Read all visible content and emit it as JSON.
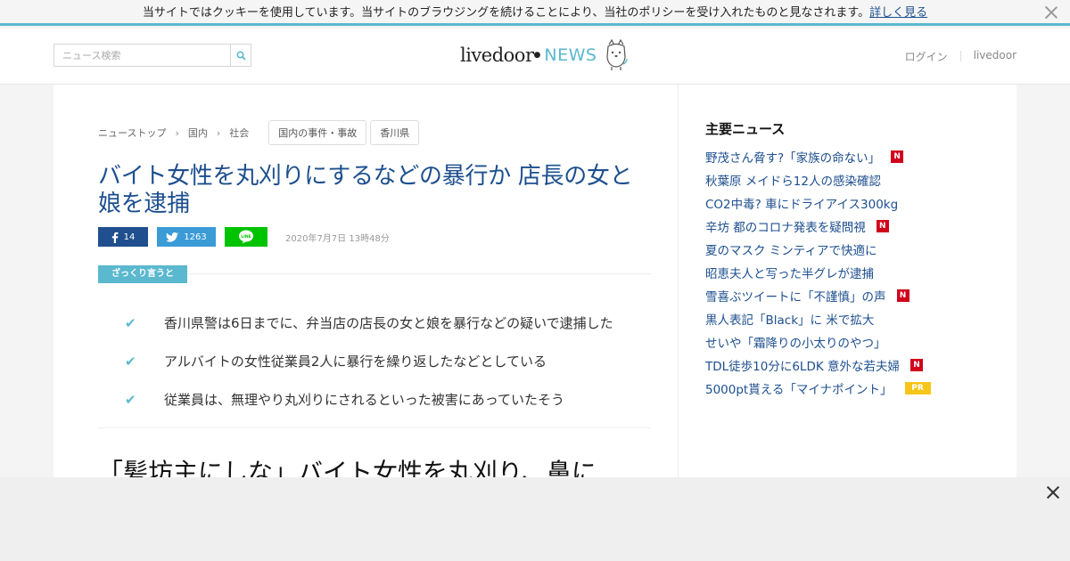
{
  "cookie": {
    "text": "当サイトではクッキーを使用しています。当サイトのブラウジングを続けることにより、当社のポリシーを受け入れたものと見なされます。",
    "learn_more": "詳しく見る"
  },
  "header": {
    "search_placeholder": "ニュース検索",
    "logo_word": "livedoor",
    "logo_news": "NEWS",
    "login": "ログイン",
    "livedoor_link": "livedoor"
  },
  "breadcrumb": {
    "items": [
      "ニューストップ",
      "国内",
      "社会"
    ],
    "tags": [
      "国内の事件・事故",
      "香川県"
    ]
  },
  "article": {
    "title": "バイト女性を丸刈りにするなどの暴行か 店長の女と娘を逮捕",
    "facebook_count": "14",
    "twitter_count": "1263",
    "date": "2020年7月7日 13時48分",
    "summary_label": "ざっくり言うと",
    "points": [
      "香川県警は6日までに、弁当店の店長の女と娘を暴行などの疑いで逮捕した",
      "アルバイトの女性従業員2人に暴行を繰り返したなどとしている",
      "従業員は、無理やり丸刈りにされるといった被害にあっていたそう"
    ],
    "headline": "「髪坊主にしな」バイト女性を丸刈り、鼻に"
  },
  "sidebar": {
    "title": "主要ニュース",
    "news": [
      {
        "text": "野茂さん脅す?「家族の命ない」",
        "badge": "N"
      },
      {
        "text": "秋葉原 メイドら12人の感染確認",
        "badge": ""
      },
      {
        "text": "CO2中毒? 車にドライアイス300kg",
        "badge": ""
      },
      {
        "text": "辛坊 都のコロナ発表を疑問視",
        "badge": "N"
      },
      {
        "text": "夏のマスク ミンティアで快適に",
        "badge": ""
      },
      {
        "text": "昭恵夫人と写った半グレが逮捕",
        "badge": ""
      },
      {
        "text": "雪喜ぶツイートに「不謹慎」の声",
        "badge": "N"
      },
      {
        "text": "黒人表記「Black」に 米で拡大",
        "badge": ""
      },
      {
        "text": "せいや「霜降りの小太りのやつ」",
        "badge": ""
      },
      {
        "text": "TDL徒歩10分に6LDK 意外な若夫婦",
        "badge": "N"
      },
      {
        "text": "5000pt貰える「マイナポイント」",
        "badge": "PR"
      }
    ]
  },
  "colors": {
    "accent": "#5ab8cf",
    "link": "#1d4f8f",
    "badge_new": "#d0021b",
    "badge_pr": "#f5c518"
  }
}
